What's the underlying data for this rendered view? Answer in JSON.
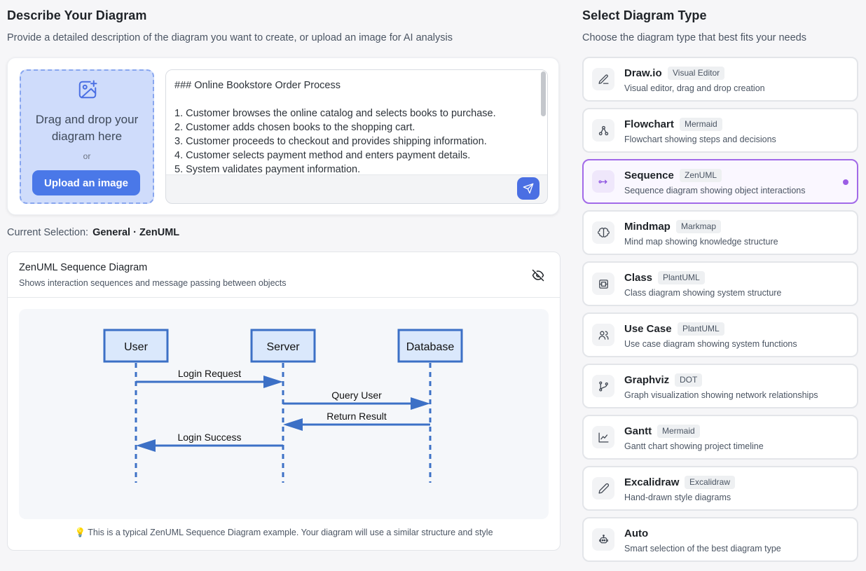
{
  "left": {
    "title": "Describe Your Diagram",
    "subtitle": "Provide a detailed description of the diagram you want to create, or upload an image for AI analysis",
    "dropzone": {
      "title_line1": "Drag and drop your",
      "title_line2": "diagram here",
      "or": "or",
      "upload_label": "Upload an image"
    },
    "textarea_lines": [
      "### Online Bookstore Order Process",
      "",
      "1. Customer browses the online catalog and selects books to purchase.",
      "2. Customer adds chosen books to the shopping cart.",
      "3. Customer proceeds to checkout and provides shipping information.",
      "4. Customer selects payment method and enters payment details.",
      "5. System validates payment information."
    ],
    "selection_label": "Current Selection:",
    "selection_value": "General · ZenUML",
    "example": {
      "title": "ZenUML Sequence Diagram",
      "description": "Shows interaction sequences and message passing between objects",
      "hint": "💡 This is a typical ZenUML Sequence Diagram example. Your diagram will use a similar structure and style",
      "participants": [
        "User",
        "Server",
        "Database"
      ],
      "messages": [
        {
          "label": "Login Request",
          "from": 0,
          "to": 1
        },
        {
          "label": "Query User",
          "from": 1,
          "to": 2
        },
        {
          "label": "Return Result",
          "from": 2,
          "to": 1
        },
        {
          "label": "Login Success",
          "from": 1,
          "to": 0
        }
      ]
    }
  },
  "right": {
    "title": "Select Diagram Type",
    "subtitle": "Choose the diagram type that best fits your needs",
    "types": [
      {
        "name": "Draw.io",
        "badge": "Visual Editor",
        "desc": "Visual editor, drag and drop creation",
        "icon": "edit-icon"
      },
      {
        "name": "Flowchart",
        "badge": "Mermaid",
        "desc": "Flowchart showing steps and decisions",
        "icon": "flowchart-icon"
      },
      {
        "name": "Sequence",
        "badge": "ZenUML",
        "desc": "Sequence diagram showing object interactions",
        "icon": "sequence-icon",
        "selected": true
      },
      {
        "name": "Mindmap",
        "badge": "Markmap",
        "desc": "Mind map showing knowledge structure",
        "icon": "brain-icon"
      },
      {
        "name": "Class",
        "badge": "PlantUML",
        "desc": "Class diagram showing system structure",
        "icon": "class-icon"
      },
      {
        "name": "Use Case",
        "badge": "PlantUML",
        "desc": "Use case diagram showing system functions",
        "icon": "users-icon"
      },
      {
        "name": "Graphviz",
        "badge": "DOT",
        "desc": "Graph visualization showing network relationships",
        "icon": "git-branch-icon"
      },
      {
        "name": "Gantt",
        "badge": "Mermaid",
        "desc": "Gantt chart showing project timeline",
        "icon": "chart-icon"
      },
      {
        "name": "Excalidraw",
        "badge": "Excalidraw",
        "desc": "Hand-drawn style diagrams",
        "icon": "pencil-icon"
      },
      {
        "name": "Auto",
        "badge": "",
        "desc": "Smart selection of the best diagram type",
        "icon": "robot-icon"
      }
    ]
  },
  "colors": {
    "accent": "#4a78e8",
    "selected_border": "#a26ae8",
    "diagram_box_fill": "#dae8fc",
    "diagram_box_stroke": "#3c70c6"
  }
}
